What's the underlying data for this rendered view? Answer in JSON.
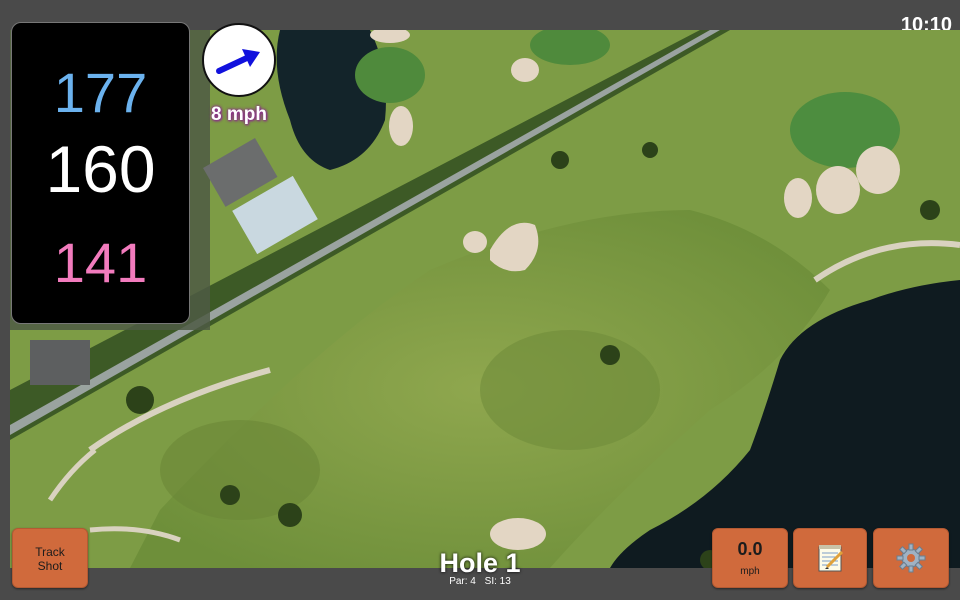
{
  "status_bar": {
    "time": "10:10"
  },
  "distances": {
    "back": "177",
    "middle": "160",
    "front": "141"
  },
  "wind": {
    "speed_text": "8 mph",
    "icon": "wind-arrow-icon",
    "arrow_color": "#1111dd"
  },
  "buttons": {
    "track_shot_line1": "Track",
    "track_shot_line2": "Shot",
    "speed_value": "0.0",
    "speed_unit": "mph",
    "notes_icon": "notepad-icon",
    "settings_icon": "gear-icon",
    "accent": "#d06a3c"
  },
  "hole": {
    "title": "Hole 1",
    "par": "Par: 4",
    "si": "SI: 13"
  },
  "colors": {
    "back_distance": "#6bb2ee",
    "mid_distance": "#ffffff",
    "front_distance": "#f27bbd",
    "wind_label_glow": "#8b2c8b"
  }
}
